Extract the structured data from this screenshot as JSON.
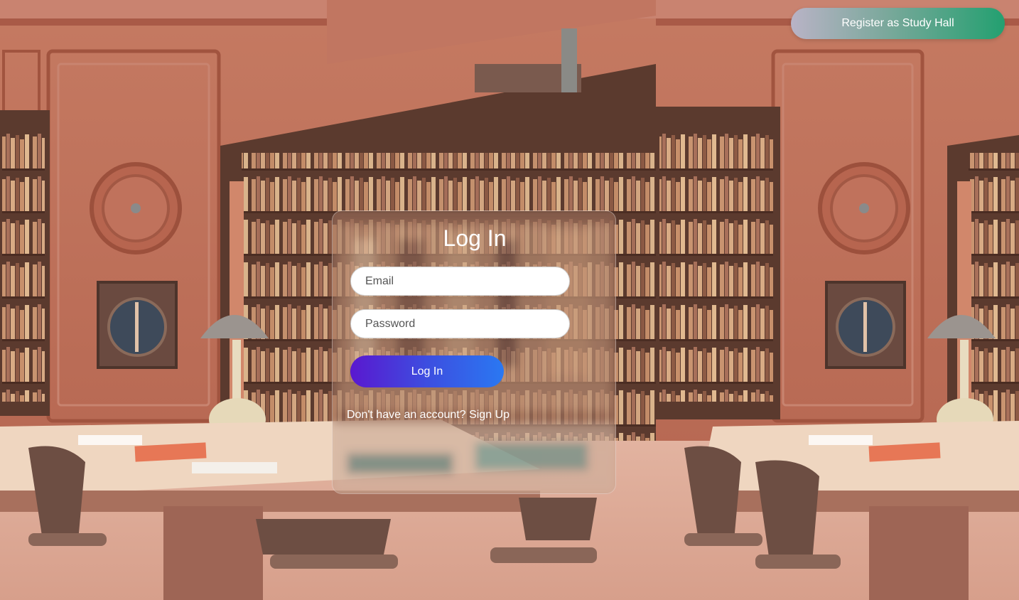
{
  "header": {
    "register_label": "Register as Study Hall"
  },
  "login": {
    "title": "Log In",
    "email_placeholder": "Email",
    "password_placeholder": "Password",
    "submit_label": "Log In",
    "signup_prompt": "Don't have an account?",
    "signup_link": "Sign Up"
  },
  "colors": {
    "wall": "#b86a55",
    "register_gradient_end": "#23a070",
    "login_gradient_start": "#5a18cf",
    "login_gradient_end": "#2a78f2"
  }
}
